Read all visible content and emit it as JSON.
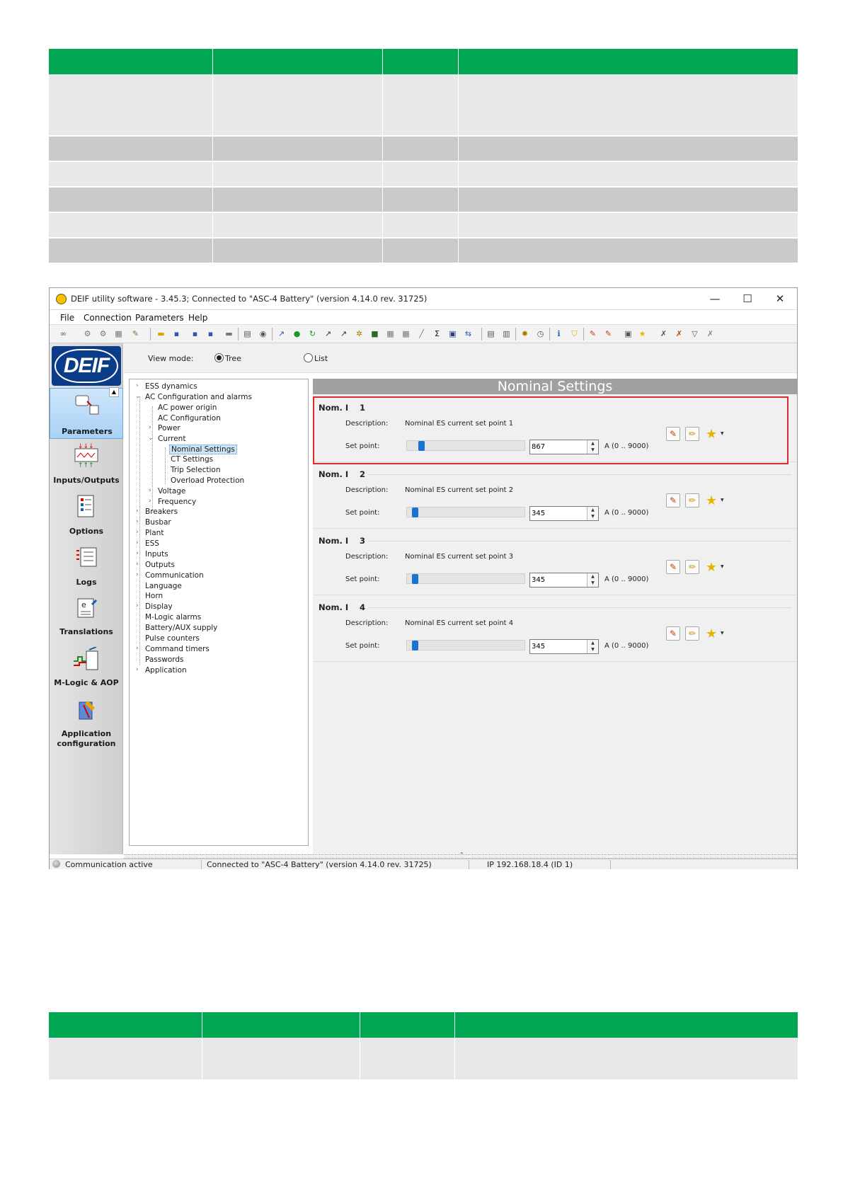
{
  "window": {
    "title": "DEIF utility software - 3.45.3; Connected to \"ASC-4 Battery\" (version 4.14.0 rev. 31725)",
    "minimize": "—",
    "maximize": "☐",
    "close": "✕"
  },
  "menu": [
    "File",
    "Connection",
    "Parameters",
    "Help"
  ],
  "logo": "DEIF",
  "nav": [
    {
      "label": "Parameters",
      "icon": "parameters-icon"
    },
    {
      "label": "Inputs/Outputs",
      "icon": "inputs-outputs-icon"
    },
    {
      "label": "Options",
      "icon": "options-icon"
    },
    {
      "label": "Logs",
      "icon": "logs-icon"
    },
    {
      "label": "Translations",
      "icon": "translations-icon"
    },
    {
      "label": "M-Logic & AOP",
      "icon": "mlogic-icon"
    },
    {
      "label": "Application",
      "label2": "configuration",
      "icon": "application-configuration-icon"
    }
  ],
  "view_mode": {
    "label": "View mode:",
    "tree": "Tree",
    "list": "List",
    "selected": "Tree"
  },
  "tree": {
    "items": [
      "ESS dynamics",
      "AC Configuration and alarms",
      "AC power origin",
      "AC Configuration",
      "Power",
      "Current",
      "Nominal Settings",
      "CT Settings",
      "Trip Selection",
      "Overload Protection",
      "Voltage",
      "Frequency",
      "Breakers",
      "Busbar",
      "Plant",
      "ESS",
      "Inputs",
      "Outputs",
      "Communication",
      "Language",
      "Horn",
      "Display",
      "M-Logic alarms",
      "Battery/AUX supply",
      "Pulse counters",
      "Command timers",
      "Passwords",
      "Application"
    ],
    "selected": "Nominal Settings"
  },
  "content": {
    "title": "Nominal Settings",
    "desc_label": "Description:",
    "setpoint_label": "Set point:",
    "params": [
      {
        "head": "Nom. I",
        "num": "1",
        "description": "Nominal ES current set point 1",
        "value": "867",
        "range": "A (0 .. 9000)",
        "level": 867
      },
      {
        "head": "Nom. I",
        "num": "2",
        "description": "Nominal ES current set point 2",
        "value": "345",
        "range": "A (0 .. 9000)",
        "level": 345
      },
      {
        "head": "Nom. I",
        "num": "3",
        "description": "Nominal ES current set point 3",
        "value": "345",
        "range": "A (0 .. 9000)",
        "level": 345
      },
      {
        "head": "Nom. I",
        "num": "4",
        "description": "Nominal ES current set point 4",
        "value": "345",
        "range": "A (0 .. 9000)",
        "level": 345
      }
    ],
    "range_max": 9000,
    "highlight_color": "#e0282e"
  },
  "status": {
    "comm": "Communication active",
    "connected": "Connected to \"ASC-4 Battery\" (version 4.14.0 rev. 31725)",
    "ip": "IP 192.168.18.4 (ID 1)"
  },
  "colors": {
    "table_header": "#00a651",
    "accent": "#1a73d1"
  }
}
